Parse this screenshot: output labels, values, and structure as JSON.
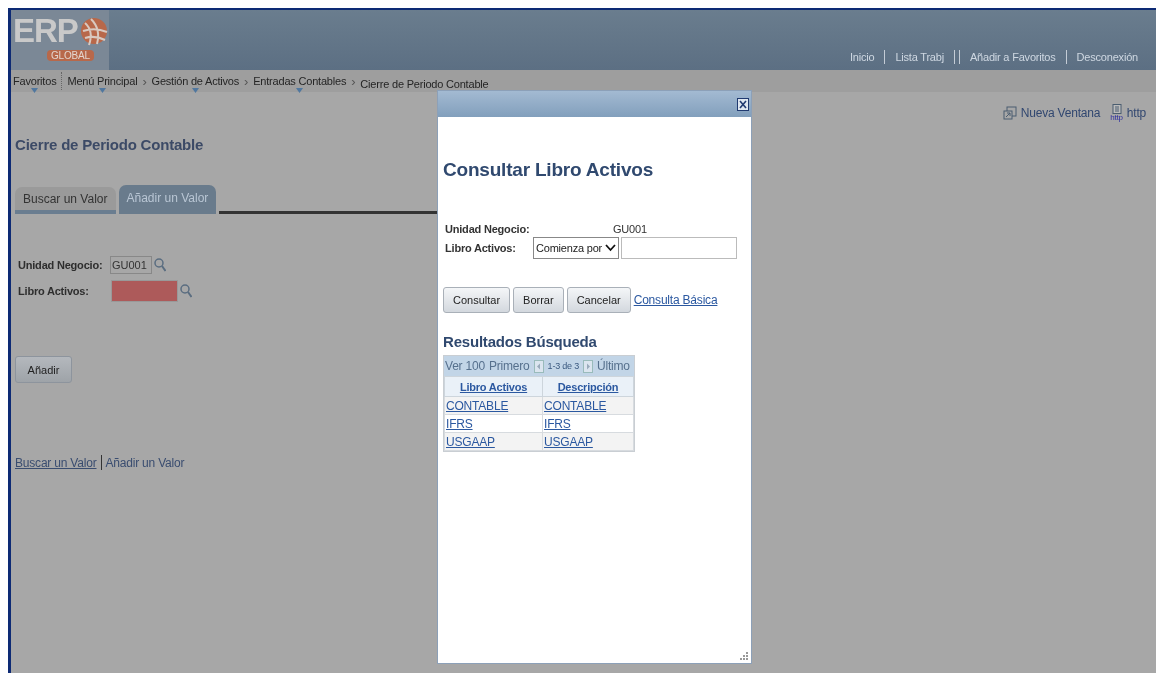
{
  "logo": {
    "main": "ERP",
    "sub": "GLOBAL"
  },
  "header_links": [
    "Inicio",
    "Lista Trabj",
    "Añadir a Favoritos",
    "Desconexión"
  ],
  "breadcrumb": [
    {
      "label": "Favoritos",
      "has_menu": true
    },
    {
      "label": "Menú Principal",
      "has_menu": true
    },
    {
      "label": "Gestión de Activos",
      "has_menu": true,
      "separator": "›"
    },
    {
      "label": "Entradas Contables",
      "has_menu": true,
      "separator": "›"
    },
    {
      "label": "Cierre de Periodo Contable",
      "has_menu": false,
      "separator": "›"
    }
  ],
  "page_tools": [
    {
      "label": "Nueva Ventana",
      "kind": "window"
    },
    {
      "label": "http",
      "kind": "http",
      "icon_label": "http"
    }
  ],
  "page_title": "Cierre de Periodo Contable",
  "tabs": [
    {
      "label": "Buscar un Valor",
      "selected": false
    },
    {
      "label": "Añadir un Valor",
      "selected": true
    }
  ],
  "fields": [
    {
      "label": "Unidad Negocio:",
      "value": "GU001",
      "required": false
    },
    {
      "label": "Libro Activos:",
      "required": true
    }
  ],
  "add_button": "Añadir",
  "footer_links": [
    {
      "label": "Buscar un Valor",
      "kind": "link"
    },
    {
      "label": "Añadir un Valor",
      "kind": "current"
    }
  ],
  "dialog": {
    "title": "Consultar Libro Activos",
    "criteria": [
      {
        "label": "Unidad Negocio:",
        "kind": "display",
        "value": "GU001"
      },
      {
        "label": "Libro Activos:",
        "kind": "input",
        "operator": "Comienza por"
      }
    ],
    "buttons": [
      "Consultar",
      "Borrar",
      "Cancelar"
    ],
    "basic_link": "Consulta Básica",
    "results": {
      "title": "Resultados Búsqueda",
      "view": "Ver 100",
      "first": "Primero",
      "range": "1-3 de 3",
      "last": "Último",
      "columns": [
        "Libro Activos",
        "Descripción"
      ],
      "rows": [
        [
          "CONTABLE",
          "CONTABLE"
        ],
        [
          "IFRS",
          "IFRS"
        ],
        [
          "USGAAP",
          "USGAAP"
        ]
      ]
    }
  }
}
